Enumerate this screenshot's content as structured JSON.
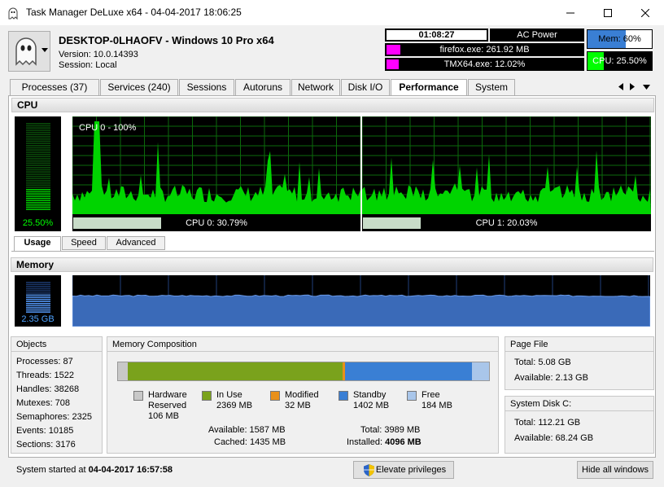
{
  "window": {
    "title": "Task Manager DeLuxe x64 - 04-04-2017 18:06:25",
    "controls": [
      "minimize",
      "maximize",
      "close"
    ]
  },
  "header": {
    "host_title": "DESKTOP-0LHAOFV - Windows 10 Pro x64",
    "version": "Version: 10.0.14393",
    "session": "Session: Local",
    "uptime": "01:08:27",
    "power": "AC Power",
    "top_processes": [
      {
        "label": "firefox.exe: 261.92 MB",
        "bar_fraction": 0.07
      },
      {
        "label": "TMX64.exe: 12.02%",
        "bar_fraction": 0.06
      }
    ],
    "mem": {
      "label": "Mem: 60%",
      "fraction": 0.6,
      "color": "#3a7fd4"
    },
    "cpu": {
      "label": "CPU: 25.50%",
      "fraction": 0.255,
      "color": "#00ff00"
    }
  },
  "tabs": [
    {
      "label": "Processes (37)",
      "active": false
    },
    {
      "label": "Services (240)",
      "active": false
    },
    {
      "label": "Sessions",
      "active": false
    },
    {
      "label": "Autoruns",
      "active": false
    },
    {
      "label": "Network",
      "active": false
    },
    {
      "label": "Disk I/O",
      "active": false
    },
    {
      "label": "Performance",
      "active": true
    },
    {
      "label": "System",
      "active": false
    }
  ],
  "cpu_section": {
    "title": "CPU",
    "total_label": "25.50%",
    "total_fraction": 0.255,
    "graph_caption": "CPU 0 - 100%",
    "cores": [
      {
        "label": "CPU 0: 30.79%",
        "fraction": 0.3079
      },
      {
        "label": "CPU 1: 20.03%",
        "fraction": 0.2003
      }
    ],
    "subtabs": [
      {
        "label": "Usage",
        "active": true
      },
      {
        "label": "Speed",
        "active": false
      },
      {
        "label": "Advanced",
        "active": false
      }
    ]
  },
  "memory_section": {
    "title": "Memory",
    "used_label": "2.35 GB",
    "used_fraction": 0.6
  },
  "objects": {
    "title": "Objects",
    "rows": [
      "Processes: 87",
      "Threads: 1522",
      "Handles: 38268",
      "Mutexes: 708",
      "Semaphores: 2325",
      "Events: 10185",
      "Sections: 3176"
    ]
  },
  "memory_composition": {
    "title": "Memory Composition",
    "segments": [
      {
        "name": "Hardware Reserved",
        "mb": 106,
        "color": "#c8c8c8"
      },
      {
        "name": "In Use",
        "mb": 2369,
        "color": "#7aa21c"
      },
      {
        "name": "Modified",
        "mb": 32,
        "color": "#e8901a"
      },
      {
        "name": "Standby",
        "mb": 1402,
        "color": "#3a7fd4"
      },
      {
        "name": "Free",
        "mb": 184,
        "color": "#a9c6ea"
      }
    ],
    "legend": [
      {
        "line1": "Hardware",
        "line2": "Reserved",
        "line3": "106 MB"
      },
      {
        "line1": "In Use",
        "line2": "2369 MB",
        "line3": ""
      },
      {
        "line1": "Modified",
        "line2": "32 MB",
        "line3": ""
      },
      {
        "line1": "Standby",
        "line2": "1402 MB",
        "line3": ""
      },
      {
        "line1": "Free",
        "line2": "184 MB",
        "line3": ""
      }
    ],
    "available": "Available: 1587 MB",
    "cached": "Cached: 1435 MB",
    "total": "Total: 3989 MB",
    "installed_label": "Installed:",
    "installed_value": "4096 MB"
  },
  "page_file": {
    "title": "Page File",
    "total": "Total: 5.08 GB",
    "available": "Available: 2.13 GB"
  },
  "system_disk": {
    "title": "System Disk C:",
    "total": "Total: 112.21 GB",
    "available": "Available: 68.24 GB"
  },
  "statusbar": {
    "started_label": "System started at",
    "started_value": "04-04-2017 16:57:58",
    "elevate_button": "Elevate privileges",
    "hide_button": "Hide all windows"
  }
}
